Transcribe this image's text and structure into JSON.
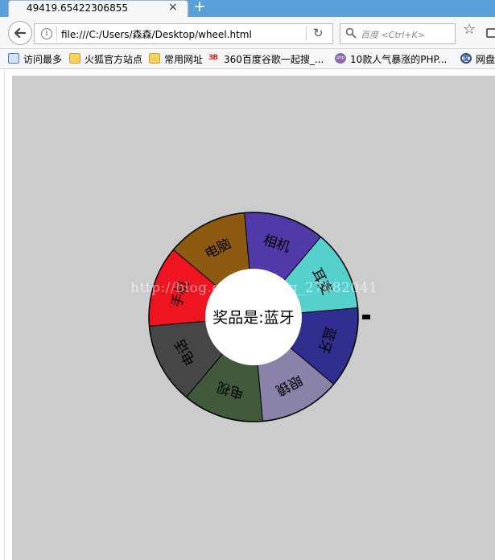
{
  "browser": {
    "tab_title": "49419.65422306855",
    "tab_close": "×",
    "new_tab": "+",
    "url": "file:///C:/Users/森森/Desktop/wheel.html",
    "search_placeholder": "百度 <Ctrl+K>",
    "bookmarks": [
      {
        "label": "访问最多",
        "icon": "bookmark-star-icon"
      },
      {
        "label": "火狐官方站点",
        "icon": "folder-icon"
      },
      {
        "label": "常用网址",
        "icon": "folder-icon"
      },
      {
        "label": "360百度谷歌一起搜_...",
        "icon": "360-icon"
      },
      {
        "label": "10款人气暴涨的PHP...",
        "icon": "php-icon"
      },
      {
        "label": "网盘",
        "icon": "pan-icon"
      }
    ]
  },
  "wheel": {
    "center_text": "奖品是:蓝牙",
    "segments": [
      {
        "label": "相机",
        "color": "#5139a8"
      },
      {
        "label": "耳麦",
        "color": "#55d0cd"
      },
      {
        "label": "蓝牙",
        "color": "#302f8f"
      },
      {
        "label": "眼镜",
        "color": "#8a82a8"
      },
      {
        "label": "电视",
        "color": "#425a3c"
      },
      {
        "label": "电话",
        "color": "#464646"
      },
      {
        "label": "手机",
        "color": "#ee1420"
      },
      {
        "label": "电脑",
        "color": "#8d5a12"
      }
    ]
  },
  "watermark": "http://blog.csdn.net/qq_27682041"
}
